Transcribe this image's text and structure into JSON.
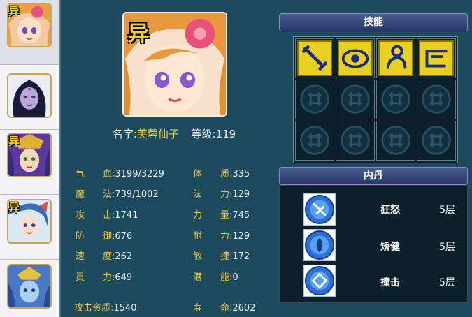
{
  "pets": [
    {
      "name": "pet-1",
      "badge": "异",
      "selected": true
    },
    {
      "name": "pet-2",
      "badge": "",
      "selected": false
    },
    {
      "name": "pet-3",
      "badge": "异",
      "selected": false
    },
    {
      "name": "pet-4",
      "badge": "异",
      "selected": false
    },
    {
      "name": "pet-5",
      "badge": "",
      "selected": false
    }
  ],
  "portrait_badge": "异",
  "profile": {
    "name_label": "名字:",
    "name": "芙蓉仙子",
    "level_label": "等级:",
    "level": "119"
  },
  "stats_left": [
    {
      "label": "气　　血:",
      "value": "3199/3229"
    },
    {
      "label": "魔　　法:",
      "value": "739/1002"
    },
    {
      "label": "攻　　击:",
      "value": "1741"
    },
    {
      "label": "防　　御:",
      "value": "676"
    },
    {
      "label": "速　　度:",
      "value": "262"
    },
    {
      "label": "灵　　力:",
      "value": "649"
    }
  ],
  "stats_right": [
    {
      "label": "体　　质:",
      "value": "335"
    },
    {
      "label": "法　　力:",
      "value": "129"
    },
    {
      "label": "力　　量:",
      "value": "745"
    },
    {
      "label": "耐　　力:",
      "value": "129"
    },
    {
      "label": "敏　　捷:",
      "value": "172"
    },
    {
      "label": "潜　　能:",
      "value": "0"
    }
  ],
  "aptitude": {
    "label": "攻击资质:",
    "value": "1540"
  },
  "lifespan": {
    "label": "寿　　命:",
    "value": "2602"
  },
  "skills_title": "技能",
  "skills": [
    {
      "icon": "sword-skill-icon",
      "active": true
    },
    {
      "icon": "eye-skill-icon",
      "active": true
    },
    {
      "icon": "figure-skill-icon",
      "active": true
    },
    {
      "icon": "bow-skill-icon",
      "active": true
    },
    {
      "icon": "empty-slot-icon",
      "active": false
    },
    {
      "icon": "empty-slot-icon",
      "active": false
    },
    {
      "icon": "empty-slot-icon",
      "active": false
    },
    {
      "icon": "empty-slot-icon",
      "active": false
    },
    {
      "icon": "empty-slot-icon",
      "active": false
    },
    {
      "icon": "empty-slot-icon",
      "active": false
    },
    {
      "icon": "empty-slot-icon",
      "active": false
    },
    {
      "icon": "empty-slot-icon",
      "active": false
    }
  ],
  "neidan_title": "内丹",
  "neidan": [
    {
      "name": "狂怒",
      "level": "5层",
      "icon": "rage-orb-icon"
    },
    {
      "name": "矫健",
      "level": "5层",
      "icon": "agility-orb-icon"
    },
    {
      "name": "撞击",
      "level": "5层",
      "icon": "impact-orb-icon"
    }
  ],
  "colors": {
    "background": "#1d4a5c",
    "label_gold": "#e6c44a",
    "name_yellow": "#f0d040",
    "value_white": "#e6eef2",
    "panel_dark": "#0c1f2a",
    "header_blue": "#3a4a80"
  }
}
